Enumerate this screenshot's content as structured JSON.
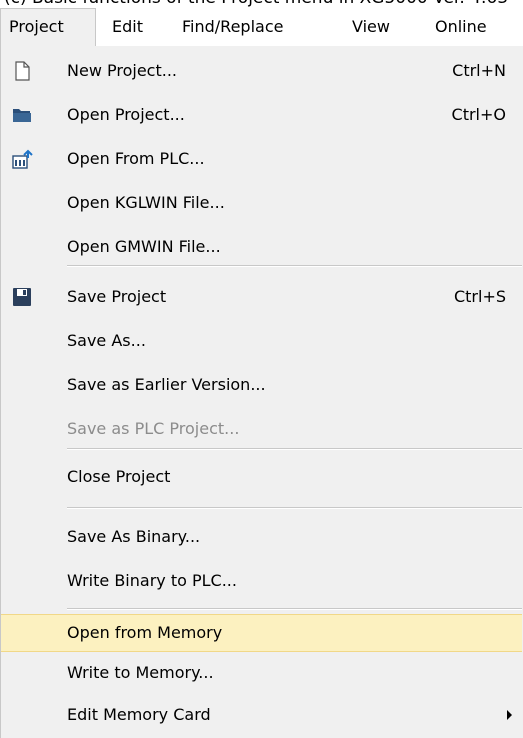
{
  "top_fragment": "(c)   Basic functions of the Project menu in XG5000 Ver. 4.63",
  "menubar": {
    "items": [
      {
        "label": "Project"
      },
      {
        "label": "Edit"
      },
      {
        "label": "Find/Replace"
      },
      {
        "label": "View"
      },
      {
        "label": "Online"
      }
    ]
  },
  "menu": {
    "items": [
      {
        "icon": "new-document-icon",
        "label": "New Project...",
        "shortcut": "Ctrl+N"
      },
      {
        "icon": "open-folder-icon",
        "label": "Open Project...",
        "shortcut": "Ctrl+O"
      },
      {
        "icon": "open-from-plc-icon",
        "label": "Open From PLC...",
        "shortcut": ""
      },
      {
        "icon": "",
        "label": "Open KGLWIN File...",
        "shortcut": ""
      },
      {
        "icon": "",
        "label": "Open GMWIN File...",
        "shortcut": ""
      },
      {
        "icon": "save-floppy-icon",
        "label": "Save Project",
        "shortcut": "Ctrl+S"
      },
      {
        "icon": "",
        "label": "Save As...",
        "shortcut": ""
      },
      {
        "icon": "",
        "label": "Save as Earlier Version...",
        "shortcut": ""
      },
      {
        "icon": "",
        "label": "Save as PLC Project...",
        "shortcut": "",
        "disabled": true
      },
      {
        "icon": "",
        "label": "Close Project",
        "shortcut": ""
      },
      {
        "icon": "",
        "label": "Save As Binary...",
        "shortcut": ""
      },
      {
        "icon": "",
        "label": "Write Binary to PLC...",
        "shortcut": ""
      },
      {
        "icon": "",
        "label": "Open from Memory",
        "shortcut": "",
        "highlighted": true
      },
      {
        "icon": "",
        "label": "Write to Memory...",
        "shortcut": ""
      },
      {
        "icon": "",
        "label": "Edit Memory Card",
        "shortcut": "",
        "submenu": true
      }
    ]
  },
  "colors": {
    "menu_bg": "#f0f0f0",
    "highlight_bg": "#fcf1c0",
    "highlight_border": "#f1d888",
    "disabled_text": "#8c8c8c",
    "separator": "#c8c8c8"
  }
}
